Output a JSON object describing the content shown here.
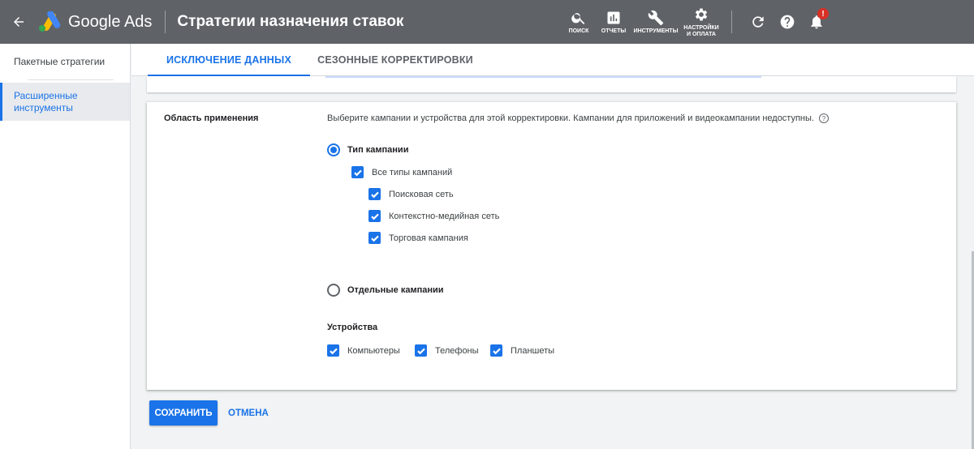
{
  "header": {
    "product_name": "Google Ads",
    "page_title": "Стратегии назначения ставок",
    "tools": [
      {
        "label": "ПОИСК",
        "icon": "search-icon"
      },
      {
        "label": "ОТЧЕТЫ",
        "icon": "reports-icon"
      },
      {
        "label": "ИНСТРУМЕНТЫ",
        "icon": "wrench-icon"
      },
      {
        "label": "НАСТРОЙКИ И ОПЛАТА",
        "icon": "settings-icon"
      }
    ],
    "notification_badge": "!"
  },
  "sidebar": {
    "items": [
      {
        "label": "Пакетные стратегии",
        "active": false
      },
      {
        "label": "Расширенные инструменты",
        "active": true
      }
    ]
  },
  "tabs": [
    {
      "label": "ИСКЛЮЧЕНИЕ ДАННЫХ",
      "active": true
    },
    {
      "label": "СЕЗОННЫЕ КОРРЕКТИРОВКИ",
      "active": false
    }
  ],
  "scope": {
    "label": "Область применения",
    "description": "Выберите кампании и устройства для этой корректировки. Кампании для приложений и видеокампании недоступны.",
    "help_icon": "?",
    "campaign_type_option": "Тип кампании",
    "all_types_label": "Все типы кампаний",
    "campaign_types": [
      "Поисковая сеть",
      "Контекстно-медийная сеть",
      "Торговая кампания"
    ],
    "individual_option": "Отдельные кампании",
    "devices_title": "Устройства",
    "devices": [
      "Компьютеры",
      "Телефоны",
      "Планшеты"
    ]
  },
  "actions": {
    "save": "СОХРАНИТЬ",
    "cancel": "ОТМЕНА"
  },
  "colors": {
    "header_bg": "#5f6368",
    "accent": "#1a73e8",
    "alert": "#d93025"
  }
}
